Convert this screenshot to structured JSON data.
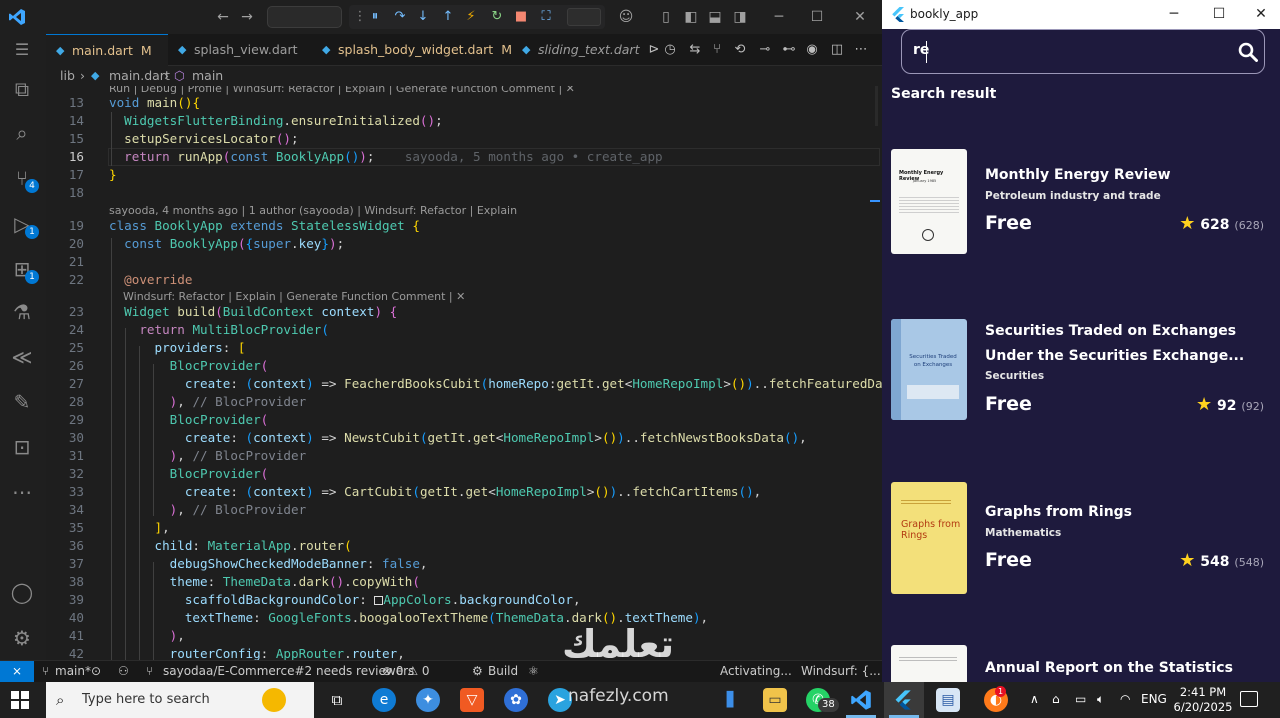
{
  "vscode": {
    "tabs": [
      {
        "label": "main.dart",
        "badge": "M"
      },
      {
        "label": "splash_view.dart",
        "badge": ""
      },
      {
        "label": "splash_body_widget.dart",
        "badge": "M"
      },
      {
        "label": "sliding_text.dart",
        "badge": ""
      }
    ],
    "breadcrumb": {
      "folder": "lib",
      "file": "main.dart",
      "symbol": "main"
    },
    "codelens": {
      "run": "Run | Debug | Profile | Windsurf: Refactor | Explain | Generate Function Comment | ✕",
      "blame_class": "sayooda, 4 months ago | 1 author (sayooda) | Windsurf: Refactor | Explain",
      "override": "Windsurf: Refactor | Explain | Generate Function Comment | ✕"
    },
    "line_numbers": [
      "13",
      "14",
      "15",
      "16",
      "17",
      "18",
      "19",
      "20",
      "21",
      "22",
      "23",
      "24",
      "25",
      "26",
      "27",
      "28",
      "29",
      "30",
      "31",
      "32",
      "33",
      "34",
      "35",
      "36",
      "37",
      "38",
      "39",
      "40",
      "41",
      "42"
    ],
    "inline_blame": "sayooda, 5 months ago • create_app",
    "statusbar": {
      "branch": "main*",
      "pr": "sayodaa/E-Commerce#2 needs reviewers",
      "problems": "⊗ 0 ⚠ 0",
      "build": "Build",
      "activating": "Activating...",
      "windsurf": "Windsurf: {...}"
    },
    "activity_badges": [
      "4",
      "1",
      "1"
    ]
  },
  "app": {
    "window_title": "bookly_app",
    "search": {
      "value": "re"
    },
    "section_title": "Search result",
    "books": [
      {
        "title": "Monthly Energy Review",
        "title2": "",
        "author": "Petroleum industry and trade",
        "price": "Free",
        "rating": "628",
        "count": "(628)",
        "cover_title": "Monthly Energy Review",
        "cover_sub": "January 1985"
      },
      {
        "title": "Securities Traded on Exchanges",
        "title2": "Under the Securities Exchange...",
        "author": "Securities",
        "price": "Free",
        "rating": "92",
        "count": "(92)",
        "cover_title": "Securities Traded on Exchanges",
        "cover_sub": ""
      },
      {
        "title": "Graphs from Rings",
        "title2": "",
        "author": "Mathematics",
        "price": "Free",
        "rating": "548",
        "count": "(548)",
        "cover_title": "Graphs from Rings",
        "cover_sub": ""
      },
      {
        "title": "Annual Report on the Statistics",
        "title2": "",
        "author": "",
        "price": "",
        "rating": "",
        "count": "",
        "cover_title": "",
        "cover_sub": ""
      }
    ]
  },
  "taskbar": {
    "search_placeholder": "Type here to search",
    "whatsapp_badge": "38",
    "firefox_badge": "1",
    "language": "ENG",
    "time": "2:41 PM",
    "date": "6/20/2025"
  },
  "watermark": {
    "arabic": "تعلمك",
    "latin": "nafezly.com"
  },
  "colors": {
    "app_bg": "#1e1a3d",
    "vscode_accent": "#0078d4",
    "star": "#ffd21f"
  }
}
